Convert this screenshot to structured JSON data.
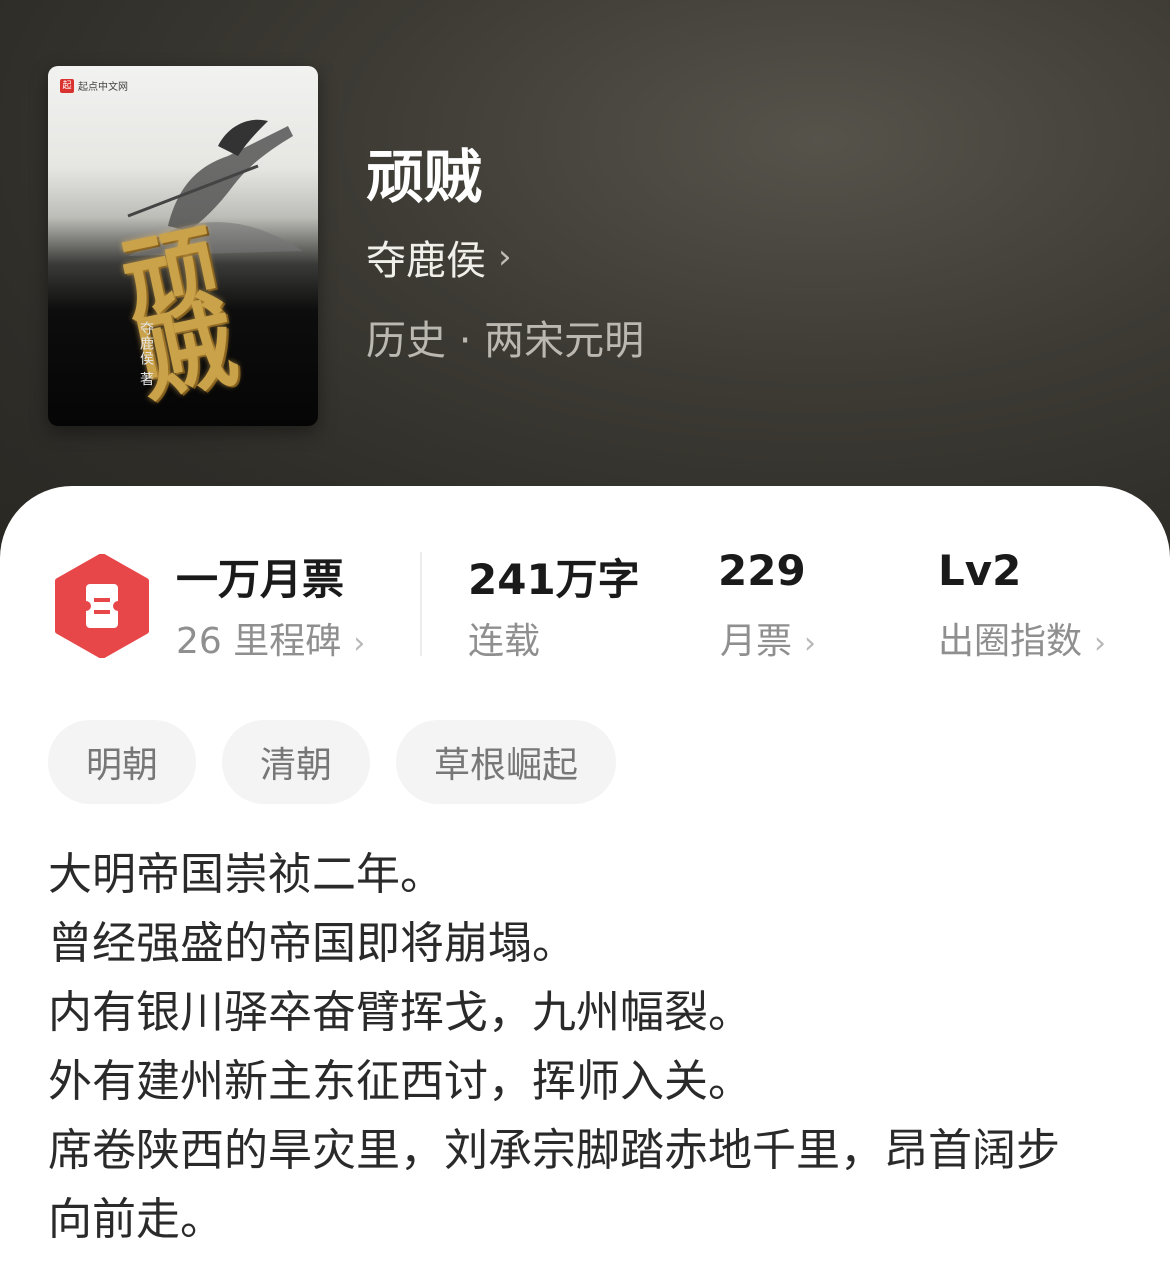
{
  "book": {
    "title": "顽贼",
    "author": "夺鹿侯",
    "author_chevron": "›",
    "category": "历史 · 两宋元明",
    "cover": {
      "badge_text": "起点中文网",
      "badge_logo": "起",
      "title_text": "顽贼",
      "author_text": "夺鹿侯 著"
    }
  },
  "stats": [
    {
      "main": "一万月票",
      "sub": "26 里程碑",
      "chevron": "›"
    },
    {
      "main": "241万字",
      "sub": "连载",
      "chevron": ""
    },
    {
      "main": "229",
      "sub": "月票",
      "chevron": "›"
    },
    {
      "main": "Lv2",
      "sub": "出圈指数",
      "chevron": "›"
    }
  ],
  "tags": [
    "明朝",
    "清朝",
    "草根崛起"
  ],
  "description": [
    "大明帝国崇祯二年。",
    "曾经强盛的帝国即将崩塌。",
    "内有银川驿卒奋臂挥戈，九州幅裂。",
    "外有建州新主东征西讨，挥师入关。",
    "席卷陕西的旱灾里，刘承宗脚踏赤地千里，昂首阔步",
    "向前走。"
  ],
  "colors": {
    "header_bg": "#3d3b34",
    "ticket_red": "#e8474a",
    "sheet_bg": "#ffffff"
  }
}
